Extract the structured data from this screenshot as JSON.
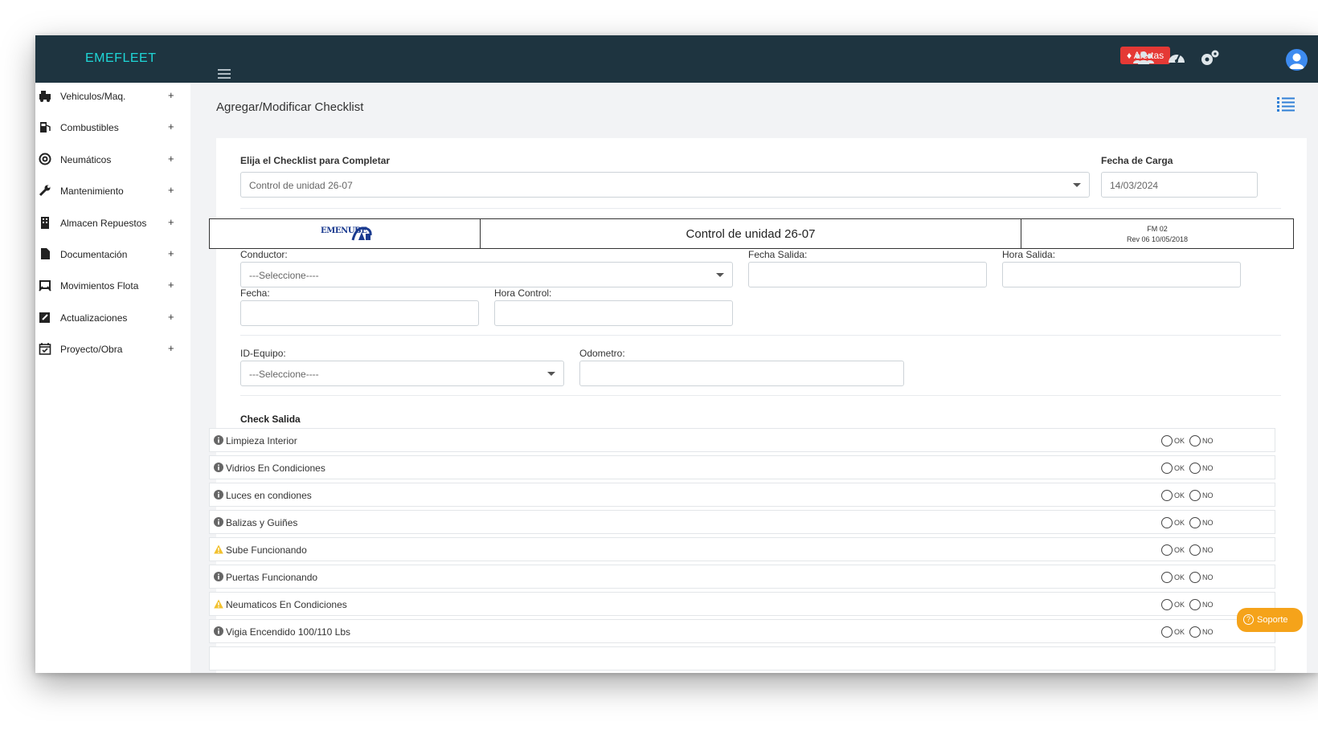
{
  "app": {
    "brand": "EMEFLEET"
  },
  "topbar": {
    "alerts_label": "Alertas",
    "icons": [
      "users-icon",
      "dashboard-gauge-icon",
      "settings-gears-icon",
      "user-avatar-icon"
    ],
    "colors": {
      "bar": "#1e3440",
      "brand": "#1ed7d7",
      "alerts": "#e53935",
      "avatar": "#3d8bf0"
    }
  },
  "sidebar": {
    "items": [
      {
        "label": "Vehiculos/Maq.",
        "icon": "vehicles-icon"
      },
      {
        "label": "Combustibles",
        "icon": "fuel-pump-icon"
      },
      {
        "label": "Neumáticos",
        "icon": "tire-icon"
      },
      {
        "label": "Mantenimiento",
        "icon": "wrench-icon"
      },
      {
        "label": "Almacen Repuestos",
        "icon": "warehouse-icon"
      },
      {
        "label": "Documentación",
        "icon": "document-icon"
      },
      {
        "label": "Movimientos Flota",
        "icon": "fleet-movement-icon"
      },
      {
        "label": "Actualizaciones",
        "icon": "edit-icon"
      },
      {
        "label": "Proyecto/Obra",
        "icon": "calendar-check-icon"
      }
    ],
    "expand_symbol": "+"
  },
  "page": {
    "title": "Agregar/Modificar Checklist"
  },
  "form": {
    "checklist_label": "Elija el Checklist para Completar",
    "checklist_value": "Control de unidad 26-07",
    "fecha_carga_label": "Fecha de Carga",
    "fecha_carga_value": "14/03/2024",
    "conductor_label": "Conductor:",
    "conductor_value": "---Seleccione----",
    "fecha_salida_label": "Fecha Salida:",
    "hora_salida_label": "Hora Salida:",
    "fecha_label": "Fecha:",
    "hora_control_label": "Hora Control:",
    "id_equipo_label": "ID-Equipo:",
    "id_equipo_value": "---Seleccione----",
    "odometro_label": "Odometro:"
  },
  "document_header": {
    "logo_text": "EMENUBE",
    "title": "Control de unidad 26-07",
    "code_line1": "FM 02",
    "code_line2": "Rev 06 10/05/2018"
  },
  "check_salida": {
    "title": "Check Salida",
    "ok_label": "OK",
    "no_label": "NO",
    "items": [
      {
        "label": "Limpieza Interior",
        "icon": "info-icon"
      },
      {
        "label": "Vidrios En Condiciones",
        "icon": "info-icon"
      },
      {
        "label": "Luces en condiones",
        "icon": "info-icon"
      },
      {
        "label": "Balizas y Guiñes",
        "icon": "info-icon"
      },
      {
        "label": "Sube Funcionando",
        "icon": "warning-icon"
      },
      {
        "label": "Puertas Funcionando",
        "icon": "info-icon"
      },
      {
        "label": "Neumaticos En Condiciones",
        "icon": "warning-icon"
      },
      {
        "label": "Vigia Encendido 100/110 Lbs",
        "icon": "info-icon"
      }
    ]
  },
  "support": {
    "label": "Soporte",
    "color": "#f5a31a"
  }
}
